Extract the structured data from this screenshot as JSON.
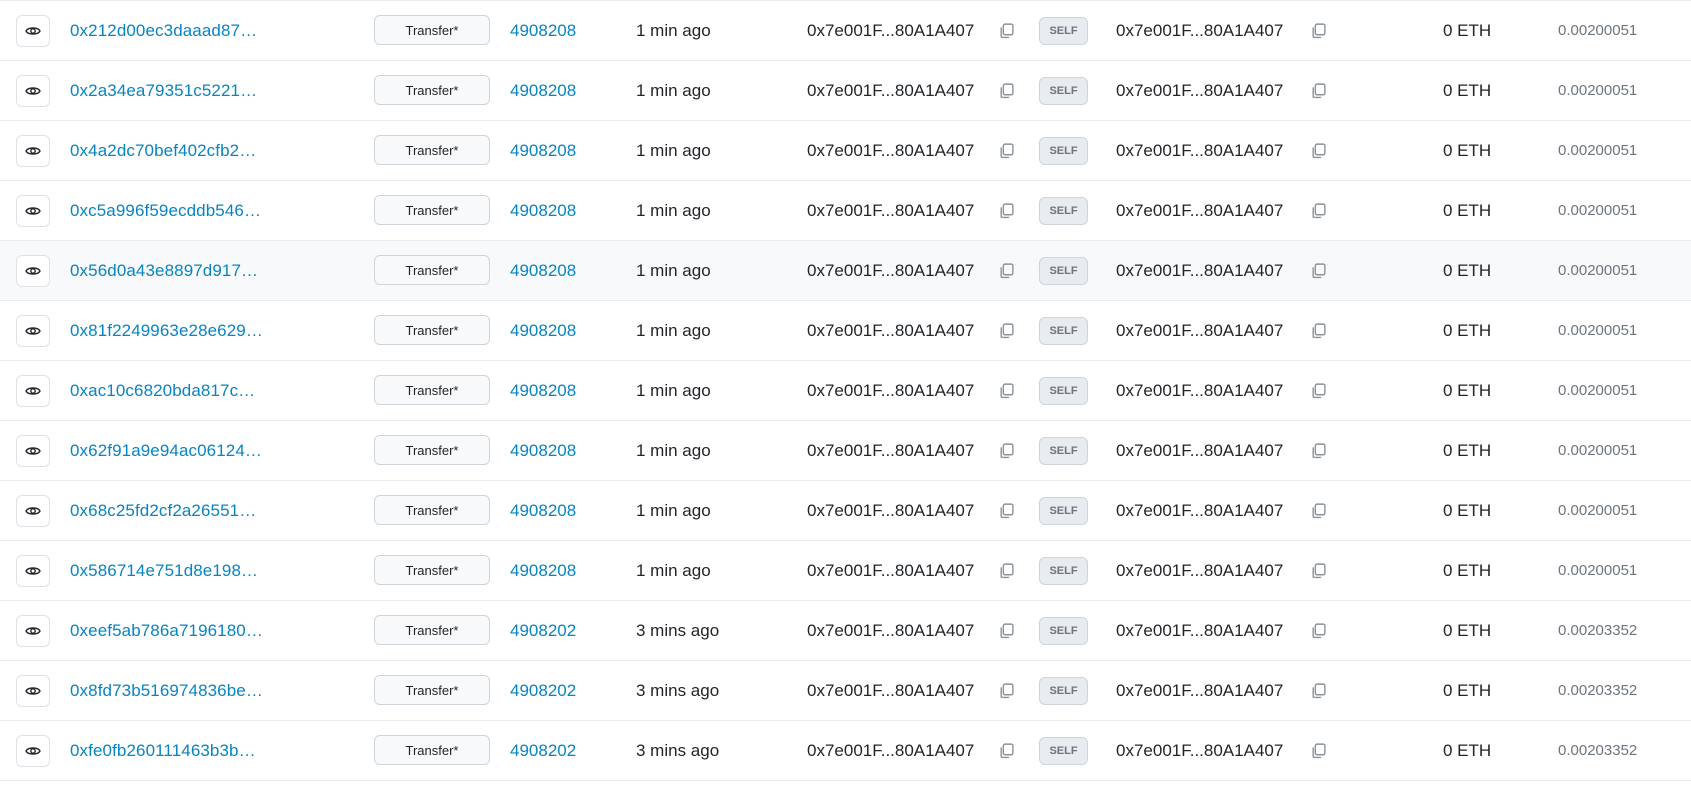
{
  "transactions": {
    "rows": [
      {
        "hash": "0x212d00ec3daaad87…",
        "method": "Transfer*",
        "block": "4908208",
        "age": "1 min ago",
        "from": "0x7e001F...80A1A407",
        "direction": "SELF",
        "to": "0x7e001F...80A1A407",
        "value": "0 ETH",
        "fee": "0.00200051"
      },
      {
        "hash": "0x2a34ea79351c5221…",
        "method": "Transfer*",
        "block": "4908208",
        "age": "1 min ago",
        "from": "0x7e001F...80A1A407",
        "direction": "SELF",
        "to": "0x7e001F...80A1A407",
        "value": "0 ETH",
        "fee": "0.00200051"
      },
      {
        "hash": "0x4a2dc70bef402cfb2…",
        "method": "Transfer*",
        "block": "4908208",
        "age": "1 min ago",
        "from": "0x7e001F...80A1A407",
        "direction": "SELF",
        "to": "0x7e001F...80A1A407",
        "value": "0 ETH",
        "fee": "0.00200051"
      },
      {
        "hash": "0xc5a996f59ecddb546…",
        "method": "Transfer*",
        "block": "4908208",
        "age": "1 min ago",
        "from": "0x7e001F...80A1A407",
        "direction": "SELF",
        "to": "0x7e001F...80A1A407",
        "value": "0 ETH",
        "fee": "0.00200051"
      },
      {
        "hash": "0x56d0a43e8897d917…",
        "method": "Transfer*",
        "block": "4908208",
        "age": "1 min ago",
        "from": "0x7e001F...80A1A407",
        "direction": "SELF",
        "to": "0x7e001F...80A1A407",
        "value": "0 ETH",
        "fee": "0.00200051"
      },
      {
        "hash": "0x81f2249963e28e629…",
        "method": "Transfer*",
        "block": "4908208",
        "age": "1 min ago",
        "from": "0x7e001F...80A1A407",
        "direction": "SELF",
        "to": "0x7e001F...80A1A407",
        "value": "0 ETH",
        "fee": "0.00200051"
      },
      {
        "hash": "0xac10c6820bda817c…",
        "method": "Transfer*",
        "block": "4908208",
        "age": "1 min ago",
        "from": "0x7e001F...80A1A407",
        "direction": "SELF",
        "to": "0x7e001F...80A1A407",
        "value": "0 ETH",
        "fee": "0.00200051"
      },
      {
        "hash": "0x62f91a9e94ac06124…",
        "method": "Transfer*",
        "block": "4908208",
        "age": "1 min ago",
        "from": "0x7e001F...80A1A407",
        "direction": "SELF",
        "to": "0x7e001F...80A1A407",
        "value": "0 ETH",
        "fee": "0.00200051"
      },
      {
        "hash": "0x68c25fd2cf2a26551…",
        "method": "Transfer*",
        "block": "4908208",
        "age": "1 min ago",
        "from": "0x7e001F...80A1A407",
        "direction": "SELF",
        "to": "0x7e001F...80A1A407",
        "value": "0 ETH",
        "fee": "0.00200051"
      },
      {
        "hash": "0x586714e751d8e198…",
        "method": "Transfer*",
        "block": "4908208",
        "age": "1 min ago",
        "from": "0x7e001F...80A1A407",
        "direction": "SELF",
        "to": "0x7e001F...80A1A407",
        "value": "0 ETH",
        "fee": "0.00200051"
      },
      {
        "hash": "0xeef5ab786a7196180…",
        "method": "Transfer*",
        "block": "4908202",
        "age": "3 mins ago",
        "from": "0x7e001F...80A1A407",
        "direction": "SELF",
        "to": "0x7e001F...80A1A407",
        "value": "0 ETH",
        "fee": "0.00203352"
      },
      {
        "hash": "0x8fd73b516974836be…",
        "method": "Transfer*",
        "block": "4908202",
        "age": "3 mins ago",
        "from": "0x7e001F...80A1A407",
        "direction": "SELF",
        "to": "0x7e001F...80A1A407",
        "value": "0 ETH",
        "fee": "0.00203352"
      },
      {
        "hash": "0xfe0fb260111463b3b…",
        "method": "Transfer*",
        "block": "4908202",
        "age": "3 mins ago",
        "from": "0x7e001F...80A1A407",
        "direction": "SELF",
        "to": "0x7e001F...80A1A407",
        "value": "0 ETH",
        "fee": "0.00203352"
      }
    ],
    "hovered_row": 4,
    "icons": {
      "details": "eye-icon",
      "copy": "copy-icon"
    },
    "colors": {
      "link": "#0784c3",
      "muted": "#6c757d",
      "border": "#e9ecef",
      "hover_bg": "#f8f9fa"
    }
  }
}
